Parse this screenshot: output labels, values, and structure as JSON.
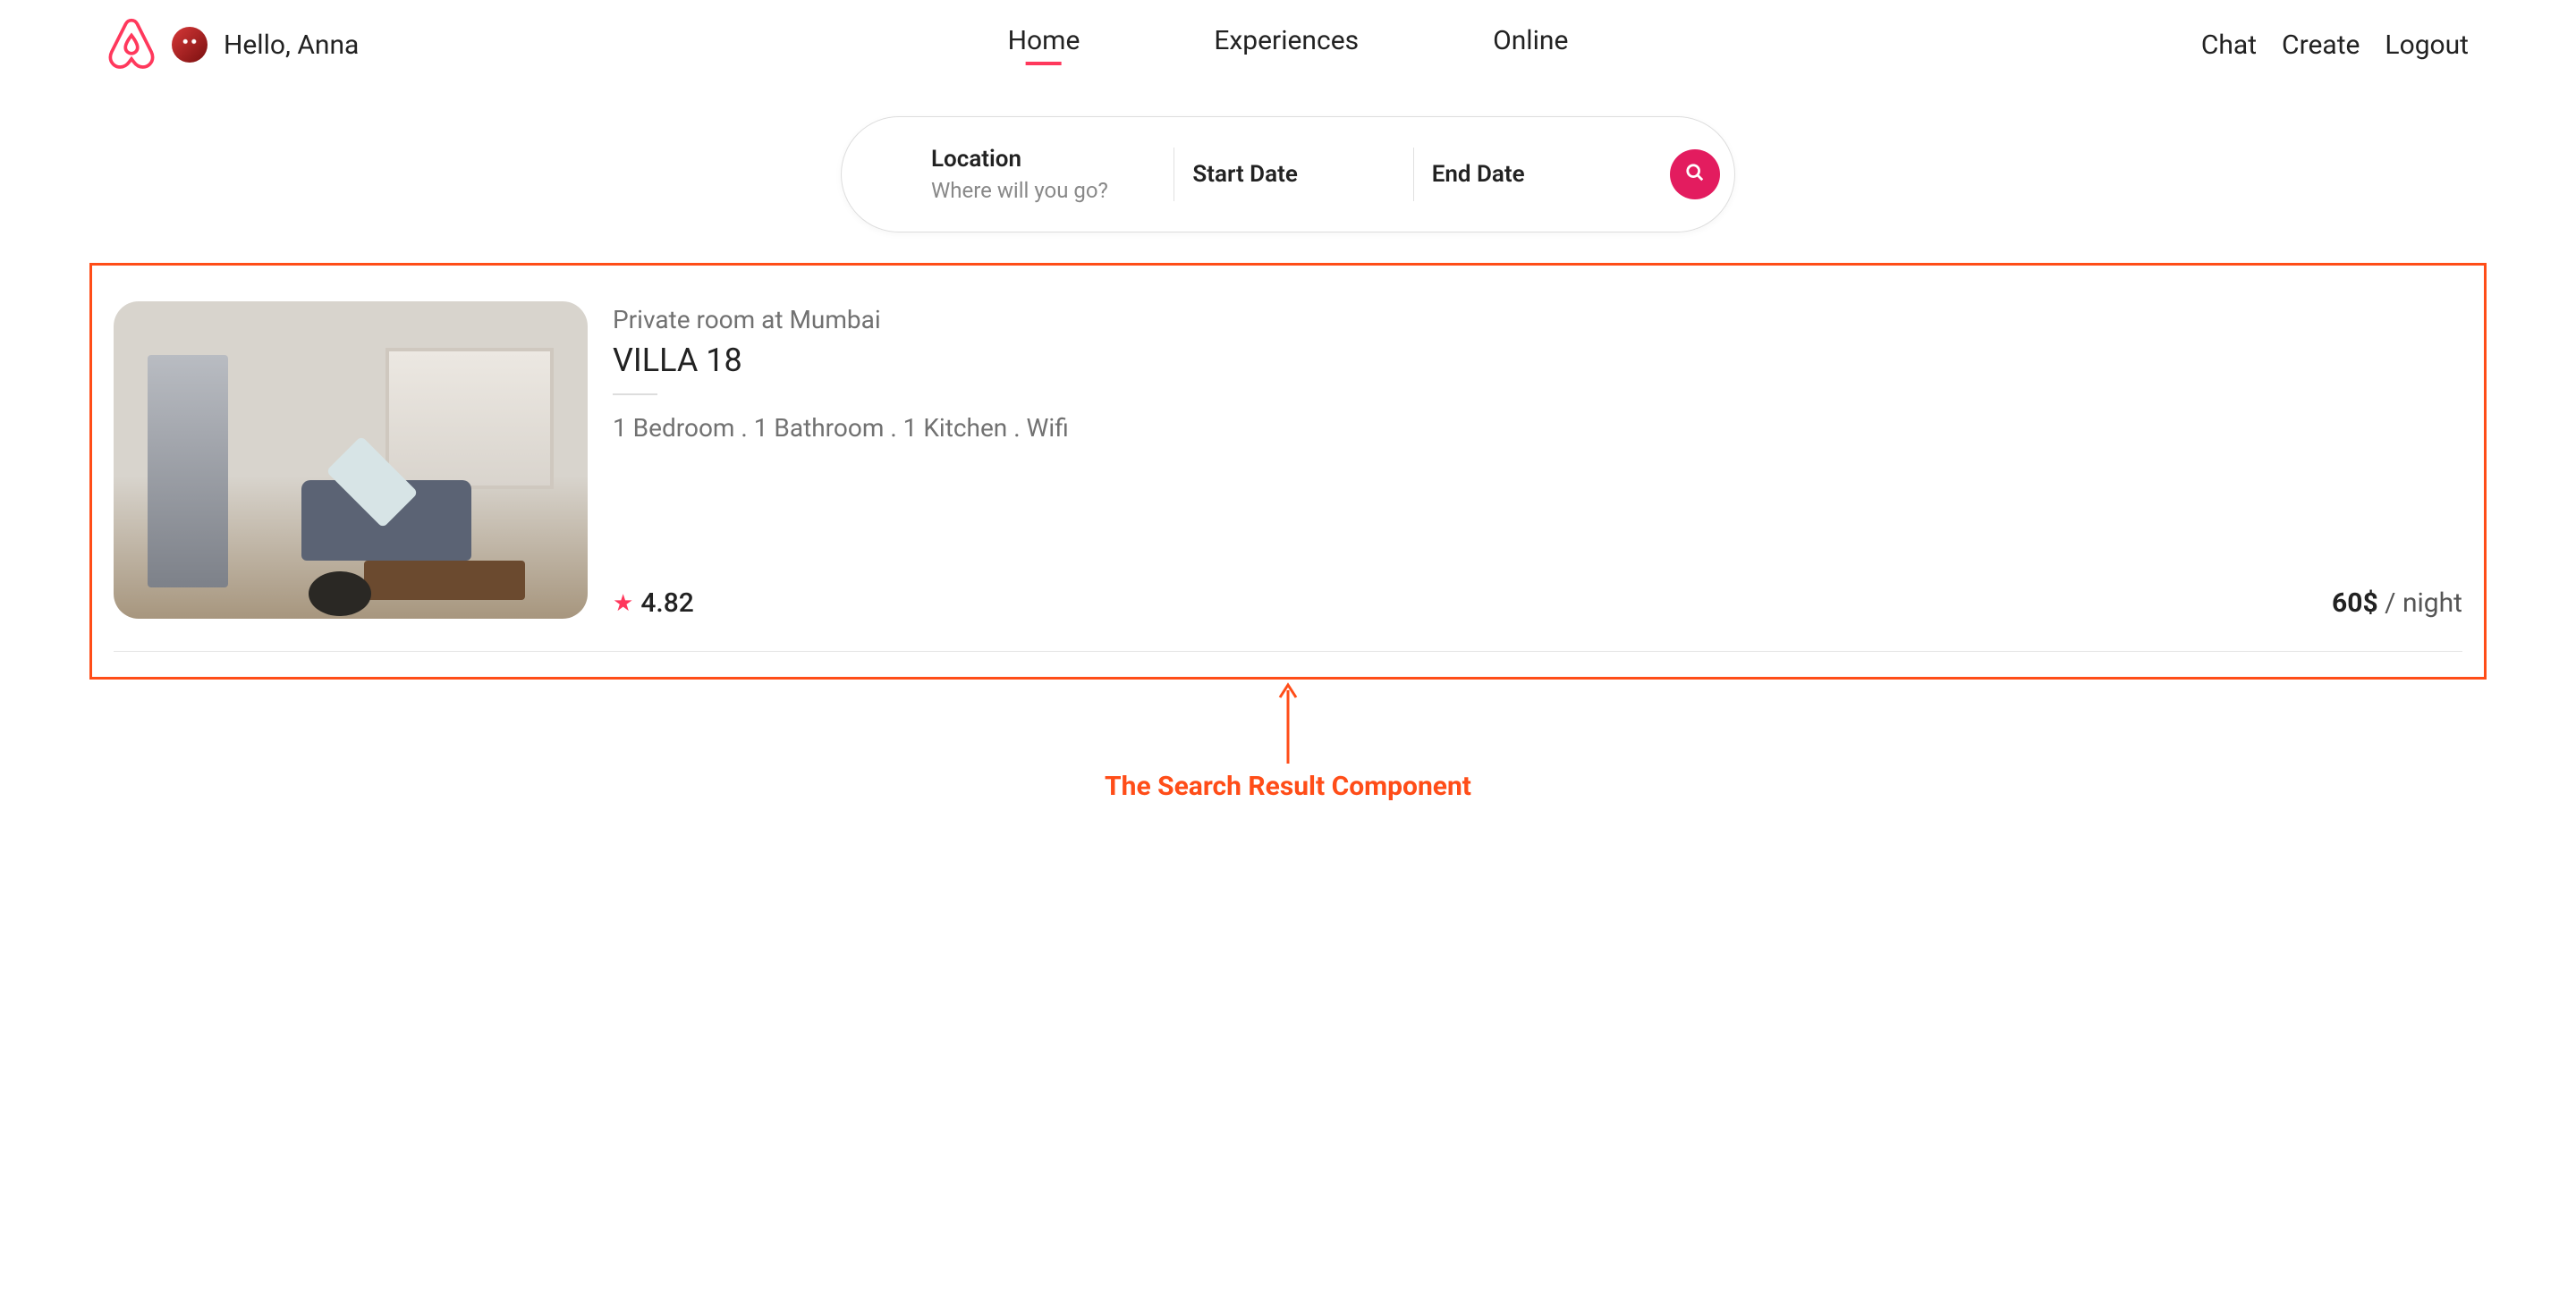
{
  "header": {
    "greeting": "Hello, Anna",
    "nav": {
      "home": "Home",
      "experiences": "Experiences",
      "online": "Online"
    },
    "right": {
      "chat": "Chat",
      "create": "Create",
      "logout": "Logout"
    }
  },
  "search": {
    "location_label": "Location",
    "location_placeholder": "Where will you go?",
    "start_label": "Start Date",
    "end_label": "End Date"
  },
  "result": {
    "subtype": "Private room at Mumbai",
    "title": "VILLA 18",
    "amenities": "1 Bedroom . 1 Bathroom . 1 Kitchen . Wifi",
    "rating": "4.82",
    "price_amount": "60$",
    "price_unit": " / night"
  },
  "annotation": {
    "label": "The Search Result Component"
  }
}
